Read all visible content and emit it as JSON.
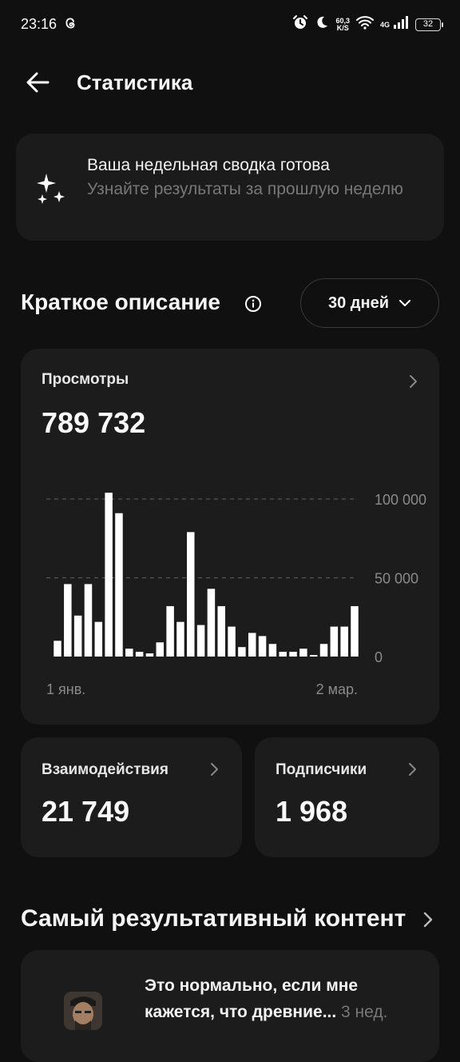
{
  "status_bar": {
    "time": "23:16",
    "speed_value": "60,3",
    "speed_unit": "K/S",
    "network": "4G",
    "battery": "32"
  },
  "appbar": {
    "title": "Статистика"
  },
  "banner": {
    "title": "Ваша недельная сводка готова",
    "subtitle": "Узнайте результаты за прошлую неделю"
  },
  "summary": {
    "title": "Краткое описание",
    "range_label": "30 дней"
  },
  "views_card": {
    "label": "Просмотры",
    "value": "789 732"
  },
  "chart_data": {
    "type": "bar",
    "x_start_label": "1 янв.",
    "x_end_label": "2 мар.",
    "y_tick_labels": [
      "100 000",
      "50 000",
      "0"
    ],
    "y_ticks": [
      100000,
      50000,
      0
    ],
    "ylim": [
      0,
      100000
    ],
    "gridlines": "dashed",
    "values": [
      10000,
      46000,
      26000,
      46000,
      22000,
      104000,
      91000,
      5000,
      3000,
      2000,
      9000,
      32000,
      22000,
      79000,
      20000,
      43000,
      32000,
      19000,
      6000,
      15000,
      13000,
      8000,
      3000,
      3000,
      5000,
      1000,
      8000,
      19000,
      19000,
      32000
    ]
  },
  "engagement_card": {
    "label": "Взаимодействия",
    "value": "21 749"
  },
  "followers_card": {
    "label": "Подписчики",
    "value": "1 968"
  },
  "top_content": {
    "title": "Самый результативный контент",
    "post_text": "Это нормально, если мне кажется, что древние...",
    "post_age": "3 нед."
  },
  "colors": {
    "background": "#101010",
    "card": "#1c1c1c",
    "bar": "#ffffff",
    "muted_text": "#777777"
  }
}
